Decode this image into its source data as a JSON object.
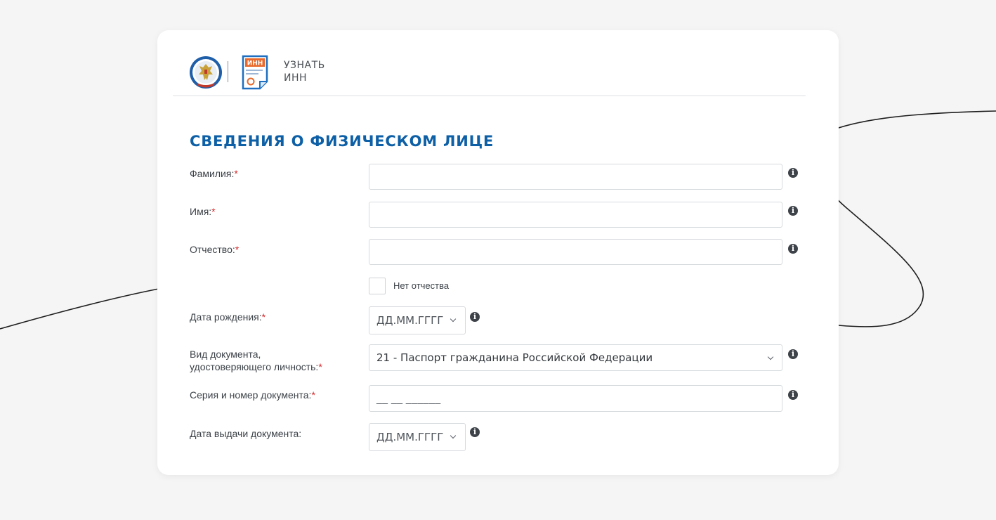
{
  "header": {
    "emblem_icon": "fns-emblem-icon",
    "inn_icon": "inn-document-icon",
    "inn_badge": "ИНН",
    "title_line1": "УЗНАТЬ",
    "title_line2": "ИНН"
  },
  "form": {
    "title": "СВЕДЕНИЯ О ФИЗИЧЕСКОМ ЛИЦЕ",
    "required_mark": "*",
    "lastname_label": "Фамилия:",
    "lastname_value": "",
    "firstname_label": "Имя:",
    "firstname_value": "",
    "patronymic_label": "Отчество:",
    "patronymic_value": "",
    "no_patronymic_label": "Нет отчества",
    "no_patronymic_checked": false,
    "birthdate_label": "Дата рождения:",
    "birthdate_value": "ДД.ММ.ГГГГ",
    "doctype_label_line1": "Вид документа,",
    "doctype_label_line2": "удостоверяющего личность:",
    "doctype_value": "21 - Паспорт гражданина Российской Федерации",
    "docnumber_label": "Серия и номер документа:",
    "docnumber_mask": "__ __ ______",
    "issuedate_label": "Дата выдачи документа:",
    "issuedate_value": "ДД.ММ.ГГГГ",
    "info_icon": "info-icon",
    "info_glyph": "i"
  },
  "colors": {
    "accent": "#0d5fa6",
    "required": "#d4272a",
    "inn_orange": "#e8692b",
    "background": "#f5f5f5"
  }
}
